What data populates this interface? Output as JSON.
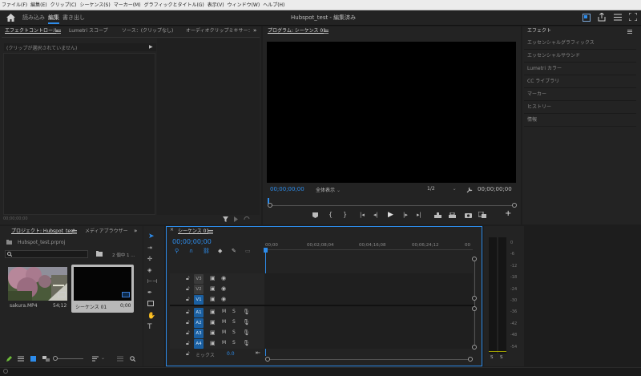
{
  "menu": [
    "ファイル(F)",
    "編集(E)",
    "クリップ(C)",
    "シーケンス(S)",
    "マーカー(M)",
    "グラフィックとタイトル(G)",
    "表示(V)",
    "ウィンドウ(W)",
    "ヘルプ(H)"
  ],
  "workspaces": {
    "tabs": [
      "読み込み",
      "編集",
      "書き出し"
    ],
    "active": "編集"
  },
  "title": "Hubspot_test - 編集済み",
  "effect_controls": {
    "tabs": [
      "エフェクトコントロール",
      "Lumetri スコープ",
      "ソース：(クリップなし)",
      "オーディオクリップミキサー："
    ],
    "no_clip": "(クリップが選択されていません)",
    "timecode": "00;00;00;00"
  },
  "program": {
    "title": "プログラム: シーケンス 01",
    "timecode_left": "00;00;00;00",
    "fit": "全体表示",
    "resolution": "1/2",
    "timecode_right": "00;00;00;00"
  },
  "effects": {
    "title": "エフェクト",
    "items": [
      "エッセンシャルグラフィックス",
      "エッセンシャルサウンド",
      "Lumetri カラー",
      "CC ライブラリ",
      "マーカー",
      "ヒストリー",
      "情報"
    ]
  },
  "project": {
    "title": "プロジェクト: Hubspot_test",
    "media_tab": "メディアブラウザー",
    "file": "Hubspot_test.prproj",
    "count": "2 個中 1 ...",
    "items": [
      {
        "name": "sakura.MP4",
        "duration": "54;12"
      },
      {
        "name": "シーケンス 01",
        "duration": "0;00"
      }
    ]
  },
  "timeline": {
    "tab": "シーケンス 01",
    "timecode": "00;00;00;00",
    "ruler": [
      "00;00",
      "00;02;08;04",
      "00;04;16;08",
      "00;06;24;12",
      "00"
    ],
    "video_tracks": [
      "V3",
      "V2",
      "V1"
    ],
    "audio_tracks": [
      "A1",
      "A2",
      "A3",
      "A4"
    ],
    "master": "ミックス",
    "master_value": "0.0",
    "mute": "M",
    "solo": "S"
  },
  "audio_meter": {
    "scale": [
      "0",
      "-6",
      "-12",
      "-18",
      "-24",
      "-30",
      "-36",
      "-42",
      "-48",
      "-54"
    ],
    "bottom": [
      "S",
      "S"
    ]
  }
}
